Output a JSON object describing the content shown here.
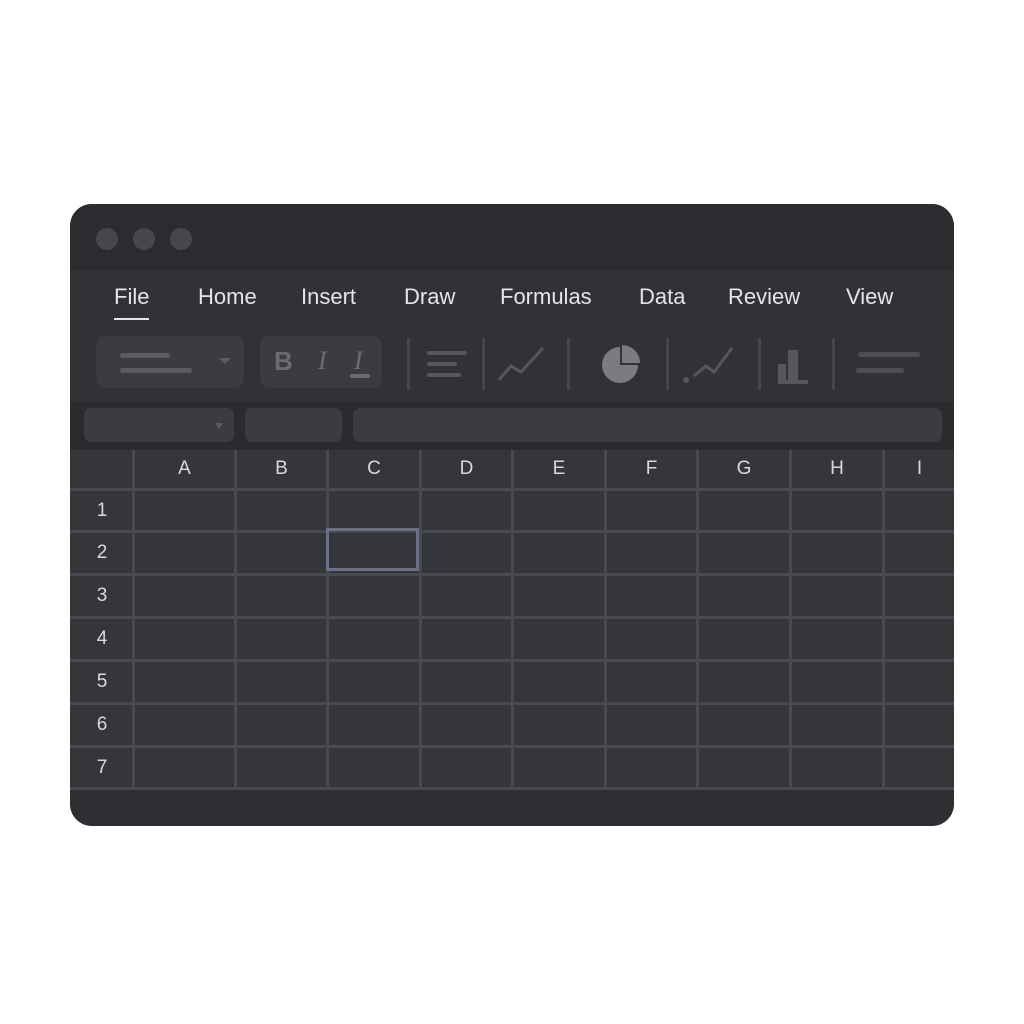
{
  "window": {
    "controls": [
      "close",
      "minimize",
      "maximize"
    ]
  },
  "menu": {
    "items": [
      {
        "label": "File",
        "active": true
      },
      {
        "label": "Home",
        "active": false
      },
      {
        "label": "Insert",
        "active": false
      },
      {
        "label": "Draw",
        "active": false
      },
      {
        "label": "Formulas",
        "active": false
      },
      {
        "label": "Data",
        "active": false
      },
      {
        "label": "Review",
        "active": false
      },
      {
        "label": "View",
        "active": false
      }
    ]
  },
  "toolbar": {
    "bold_label": "B",
    "italic_label": "I",
    "underline_label": "I",
    "icons": [
      "font-style-dropdown",
      "bold",
      "italic",
      "underline",
      "align-left",
      "line-chart",
      "pie-chart",
      "scatter-chart",
      "bar-chart",
      "more-lines"
    ]
  },
  "formula_bar": {
    "name_box_value": "",
    "function_box_value": "",
    "formula_value": ""
  },
  "sheet": {
    "columns": [
      "A",
      "B",
      "C",
      "D",
      "E",
      "F",
      "G",
      "H",
      "I"
    ],
    "rows": [
      "1",
      "2",
      "3",
      "4",
      "5",
      "6",
      "7"
    ],
    "selected_cell": {
      "column": "C",
      "row": "2"
    }
  },
  "colors": {
    "window_bg": "#2d2f33",
    "grid_bg": "#34363a",
    "grid_line": "#484a4f",
    "selection_border": "#6e7185",
    "text": "#e4e5e8"
  }
}
